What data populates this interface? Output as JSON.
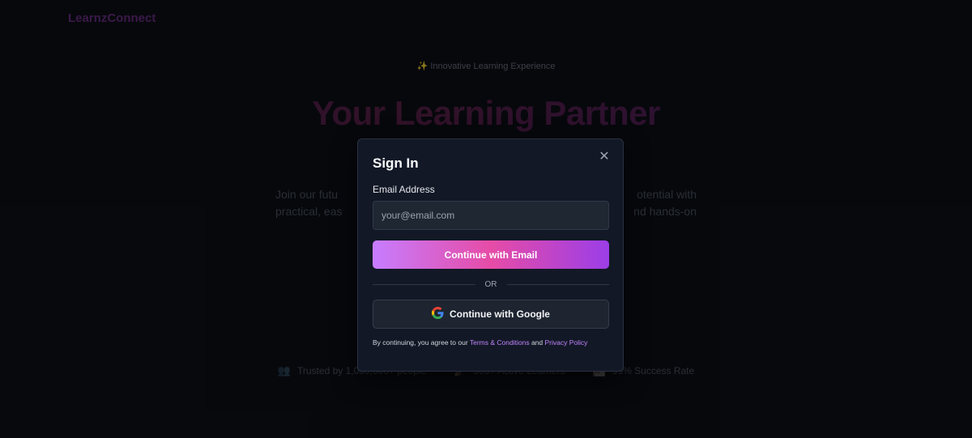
{
  "app": {
    "brand": "LearnzConnect"
  },
  "hero": {
    "badge_icon": "✨",
    "badge_text": "Innovative Learning Experience",
    "title": "Your Learning Partner",
    "subtitle_line1_left": "Join our futu",
    "subtitle_line1_right": "otential with",
    "subtitle_line2_left": "practical, eas",
    "subtitle_line2_right": "nd hands-on"
  },
  "stats": [
    {
      "icon": "👥",
      "icon_name": "people-icon",
      "text": "Trusted by 1,000,000+ people"
    },
    {
      "icon": "🚀",
      "icon_name": "rocket-icon",
      "text": "500+ Active Learners"
    },
    {
      "icon": "📈",
      "icon_name": "chart-icon",
      "text": "99% Success Rate"
    }
  ],
  "modal": {
    "title": "Sign In",
    "close_icon": "✕",
    "email_label": "Email Address",
    "email_placeholder": "your@email.com",
    "email_value": "",
    "email_button": "Continue with Email",
    "divider_text": "OR",
    "google_button": "Continue with Google",
    "legal_prefix": "By continuing, you agree to our ",
    "terms_link": "Terms & Conditions",
    "legal_and": " and ",
    "privacy_link": "Privacy Policy"
  },
  "colors": {
    "accent_start": "#c77dff",
    "accent_mid": "#e64ca6",
    "accent_end": "#9b3ee8",
    "link": "#c084fc"
  }
}
